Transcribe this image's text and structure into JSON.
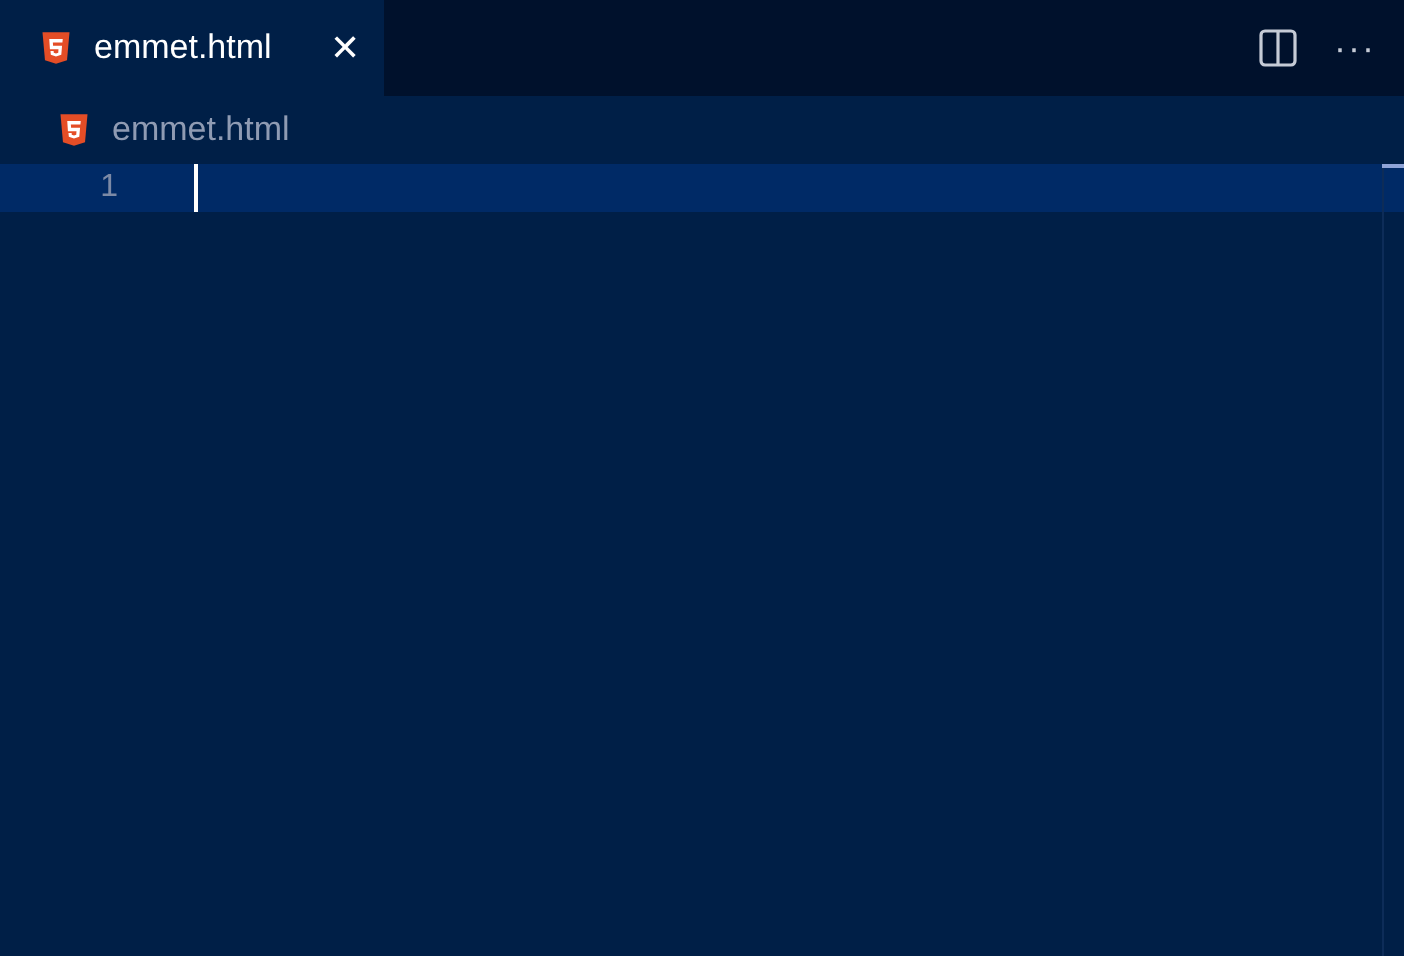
{
  "tabs": [
    {
      "label": "emmet.html",
      "selected": true,
      "close": "✕"
    }
  ],
  "actions": {
    "more": "···"
  },
  "breadcrumb": {
    "label": "emmet.html"
  },
  "editor": {
    "lines": [
      {
        "number": "1",
        "current": true
      }
    ]
  }
}
